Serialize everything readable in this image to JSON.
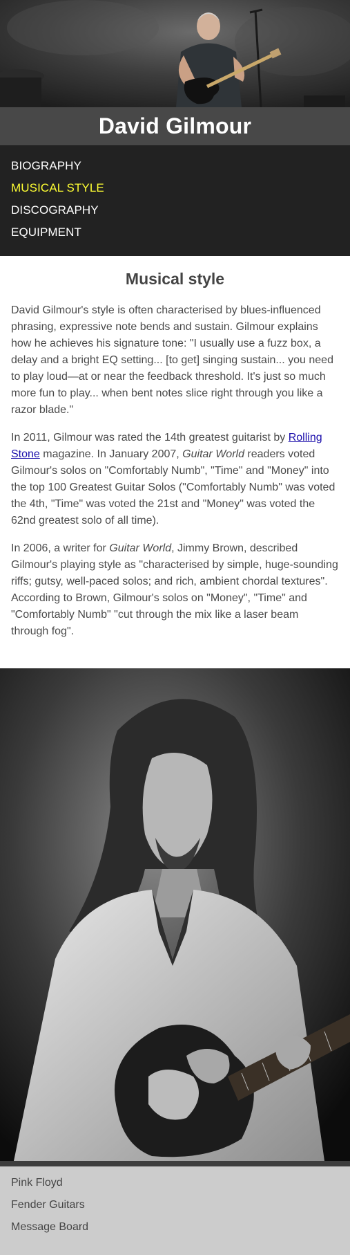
{
  "header": {
    "title": "David Gilmour"
  },
  "nav": {
    "items": [
      {
        "label": "BIOGRAPHY",
        "active": false
      },
      {
        "label": "MUSICAL STYLE",
        "active": true
      },
      {
        "label": "DISCOGRAPHY",
        "active": false
      },
      {
        "label": "EQUIPMENT",
        "active": false
      }
    ]
  },
  "main": {
    "heading": "Musical style",
    "p1": "David Gilmour's style is often characterised by blues-influenced phrasing, expressive note bends and sustain. Gilmour explains how he achieves his signature tone: \"I usually use a fuzz box, a delay and a bright EQ setting... [to get] singing sustain... you need to play loud—at or near the feedback threshold. It's just so much more fun to play... when bent notes slice right through you like a razor blade.\"",
    "p2": {
      "before": "In 2011, Gilmour was rated the 14th greatest guitarist by ",
      "link": "Rolling Stone",
      "mid": " magazine. In January 2007, ",
      "em": "Guitar World",
      "after": " readers voted Gilmour's solos on \"Comfortably Numb\", \"Time\" and \"Money\" into the top 100 Greatest Guitar Solos (\"Comfortably Numb\" was voted the 4th, \"Time\" was voted the 21st and \"Money\" was voted the 62nd greatest solo of all time)."
    },
    "p3": {
      "before": "In 2006, a writer for ",
      "em": "Guitar World",
      "after": ", Jimmy Brown, described Gilmour's playing style as \"characterised by simple, huge-sounding riffs; gutsy, well-paced solos; and rich, ambient chordal textures\". According to Brown, Gilmour's solos on \"Money\", \"Time\" and \"Comfortably Numb\" \"cut through the mix like a laser beam through fog\"."
    }
  },
  "footer": {
    "links": [
      "Pink Floyd",
      "Fender Guitars",
      "Message Board"
    ]
  },
  "colors": {
    "title_bar": "#484848",
    "nav_bg": "#222222",
    "nav_active": "#ffff33",
    "footer_bg": "#cccccc",
    "link": "#1a0dab"
  },
  "icons": {
    "hero_image": "guitarist-on-stage-photo",
    "portrait_image": "guitarist-black-and-white-portrait-photo"
  }
}
